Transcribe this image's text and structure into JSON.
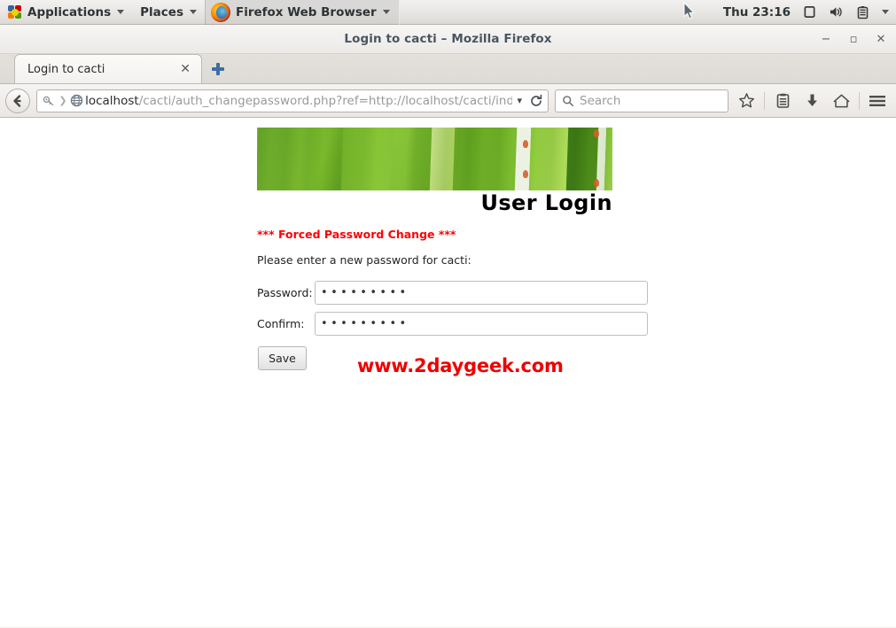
{
  "desktop_panel": {
    "applications_label": "Applications",
    "places_label": "Places",
    "window_task_label": "Firefox Web Browser",
    "clock": "Thu 23:16",
    "tray_icons": [
      "display-icon",
      "volume-icon",
      "battery-icon",
      "system-menu-caret-icon"
    ]
  },
  "browser": {
    "window_title": "Login to cacti – Mozilla Firefox",
    "window_controls": {
      "minimize": "−",
      "maximize": "▫",
      "close": "✕"
    },
    "tab": {
      "title": "Login to cacti",
      "close_label": "✕",
      "new_tab_label": "+"
    },
    "toolbar": {
      "back_label": "Back",
      "url_host": "localhost",
      "url_path": "/cacti/auth_changepassword.php?ref=http://localhost/cacti/index.ph",
      "dropdown_label": "▾",
      "reload_label": "Reload",
      "search_placeholder": "Search",
      "icons": [
        "bookmark-star-icon",
        "reader-list-icon",
        "downloads-icon",
        "home-icon",
        "menu-hamburger-icon"
      ]
    }
  },
  "page": {
    "banner_title": "User Login",
    "forced_message": "*** Forced Password Change ***",
    "instructions": "Please enter a new password for cacti:",
    "fields": [
      {
        "label": "Password:",
        "value": "•••••••••"
      },
      {
        "label": "Confirm:",
        "value": "•••••••••"
      }
    ],
    "save_button": "Save",
    "watermark": "www.2daygeek.com",
    "accent_colors": {
      "error_red": "#ff0000",
      "watermark_red": "#ee0000",
      "banner_green": "#62a320"
    }
  }
}
